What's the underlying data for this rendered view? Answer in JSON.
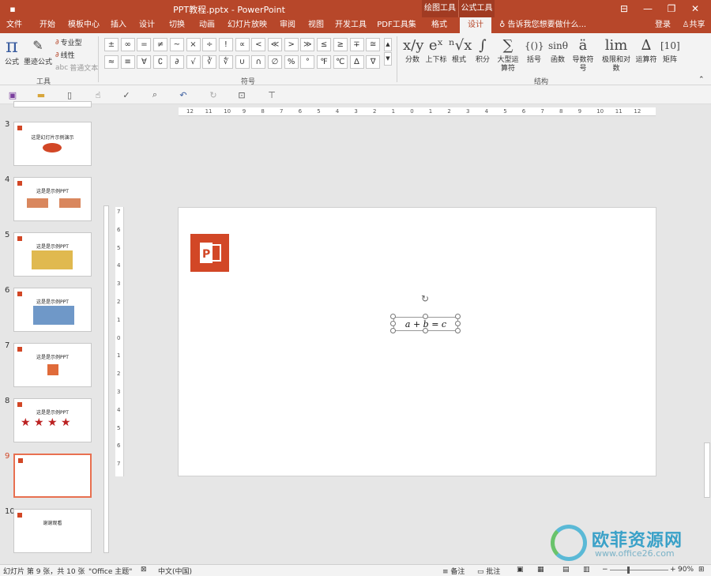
{
  "window": {
    "title": "PPT教程.pptx - PowerPoint",
    "context_tabs": [
      "绘图工具",
      "公式工具"
    ],
    "controls": [
      "⊟",
      "—",
      "❐",
      "✕"
    ]
  },
  "tabs": [
    {
      "label": "文件"
    },
    {
      "label": "开始"
    },
    {
      "label": "模板中心"
    },
    {
      "label": "插入"
    },
    {
      "label": "设计"
    },
    {
      "label": "切换"
    },
    {
      "label": "动画"
    },
    {
      "label": "幻灯片放映"
    },
    {
      "label": "审阅"
    },
    {
      "label": "视图"
    },
    {
      "label": "开发工具"
    },
    {
      "label": "PDF工具集"
    },
    {
      "label": "格式"
    },
    {
      "label": "设计"
    }
  ],
  "tellme": "告诉我您想要做什么...",
  "login": "登录",
  "share": "共享",
  "ribbon": {
    "tools": {
      "formula": "公式",
      "ink": "墨迹公式",
      "professional": "专业型",
      "linear": "线性",
      "normal_text": "普通文本",
      "group": "工具"
    },
    "symbols_group": "符号",
    "symbols_row1": [
      "±",
      "∞",
      "=",
      "≠",
      "~",
      "×",
      "÷",
      "!",
      "∝",
      "<",
      "≪",
      ">",
      "≫",
      "≤",
      "≥",
      "∓",
      "≅"
    ],
    "symbols_row2": [
      "≈",
      "≡",
      "∀",
      "∁",
      "∂",
      "√",
      "∛",
      "∜",
      "∪",
      "∩",
      "∅",
      "%",
      "°",
      "℉",
      "℃",
      "∆",
      "∇"
    ],
    "structures": [
      {
        "icon": "x/y",
        "label": "分数"
      },
      {
        "icon": "eˣ",
        "label": "上下标"
      },
      {
        "icon": "ⁿ√x",
        "label": "根式"
      },
      {
        "icon": "∫",
        "label": "积分"
      },
      {
        "icon": "∑",
        "label": "大型运算符"
      },
      {
        "icon": "{()}",
        "label": "括号"
      },
      {
        "icon": "sinθ",
        "label": "函数"
      },
      {
        "icon": "ä",
        "label": "导数符号"
      },
      {
        "icon": "lim",
        "label": "极限和对数"
      },
      {
        "icon": "∆",
        "label": "运算符"
      },
      {
        "icon": "[10]",
        "label": "矩阵"
      }
    ],
    "structures_group": "结构"
  },
  "slides": [
    {
      "num": "3",
      "title": "这是幻灯片示例演示"
    },
    {
      "num": "4",
      "title": "这是是示例PPT"
    },
    {
      "num": "5",
      "title": "这是是示例PPT"
    },
    {
      "num": "6",
      "title": "这是是示例PPT"
    },
    {
      "num": "7",
      "title": "这是是示例PPT"
    },
    {
      "num": "8",
      "title": "这是是示例PPT"
    },
    {
      "num": "9",
      "title": ""
    },
    {
      "num": "10",
      "title": "谢谢观看"
    }
  ],
  "hruler_labels": [
    "12",
    "11",
    "10",
    "9",
    "8",
    "7",
    "6",
    "5",
    "4",
    "3",
    "2",
    "1",
    "0",
    "1",
    "2",
    "3",
    "4",
    "5",
    "6",
    "7",
    "8",
    "9",
    "10",
    "11",
    "12"
  ],
  "vruler_labels": [
    "7",
    "6",
    "5",
    "4",
    "3",
    "2",
    "1",
    "0",
    "1",
    "2",
    "3",
    "4",
    "5",
    "6",
    "7"
  ],
  "equation": "a + b = c",
  "status": {
    "slide_info": "幻灯片 第 9 张，共 10 张",
    "theme": "\"Office 主题\"",
    "language": "中文(中国)",
    "notes": "备注",
    "comments": "批注",
    "zoom": "90%"
  },
  "watermark": {
    "text": "欧菲资源网",
    "url": "www.office26.com"
  }
}
